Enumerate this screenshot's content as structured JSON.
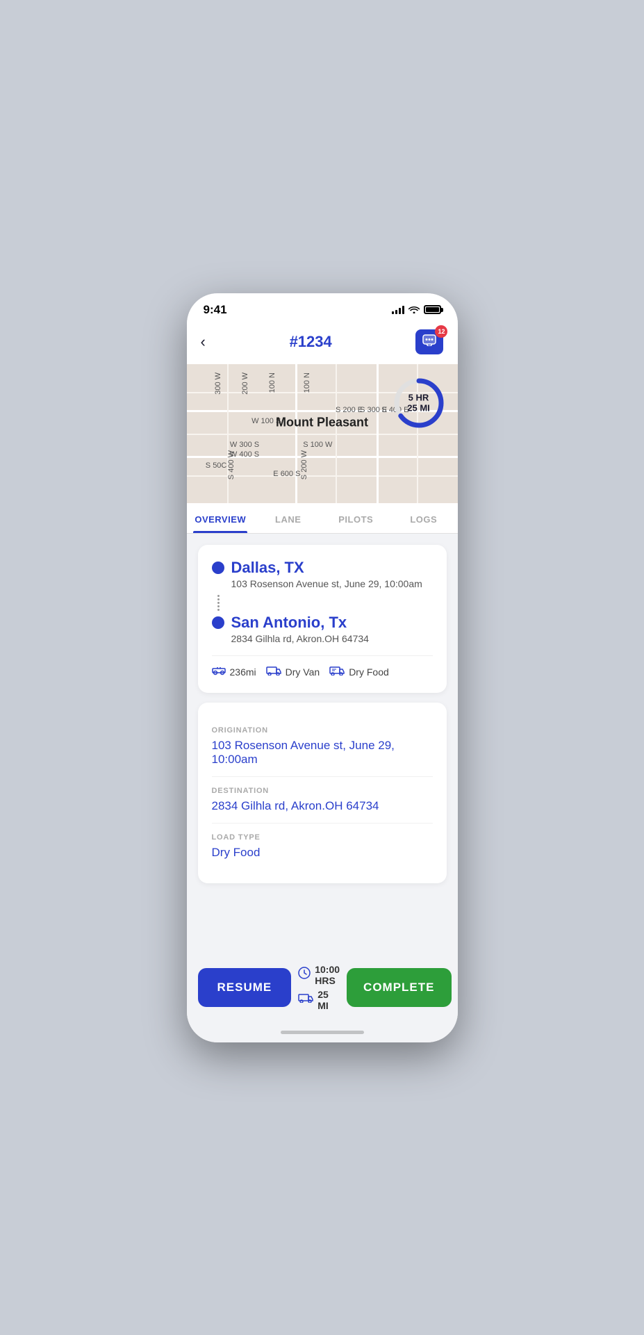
{
  "status_bar": {
    "time": "9:41"
  },
  "header": {
    "title": "#1234",
    "back_label": "‹",
    "badge_count": "12"
  },
  "map": {
    "city_label": "Mount Pleasant",
    "eta_hr": "5 HR",
    "eta_mi": "25 MI",
    "eta_progress_pct": 65
  },
  "tabs": [
    {
      "label": "OVERVIEW",
      "active": true
    },
    {
      "label": "LANE",
      "active": false
    },
    {
      "label": "PILOTS",
      "active": false
    },
    {
      "label": "LOGS",
      "active": false
    }
  ],
  "route_card": {
    "origin": {
      "city": "Dallas, TX",
      "address": "103 Rosenson Avenue st, June 29, 10:00am"
    },
    "destination": {
      "city": "San Antonio, Tx",
      "address": "2834 Gilhla rd, Akron.OH 64734"
    },
    "distance": "236mi",
    "truck_type": "Dry Van",
    "load_type": "Dry Food"
  },
  "details_card": {
    "origination_label": "ORIGINATION",
    "origination_value": "103 Rosenson Avenue st, June 29, 10:00am",
    "destination_label": "DESTINATION",
    "destination_value": "2834 Gilhla rd, Akron.OH 64734",
    "load_type_label": "LOAD TYPE",
    "load_type_value": "Dry Food"
  },
  "bottom_bar": {
    "resume_label": "RESUME",
    "complete_label": "COMPLETE",
    "hrs_label": "10:00 HRS",
    "mi_label": "25 MI"
  }
}
